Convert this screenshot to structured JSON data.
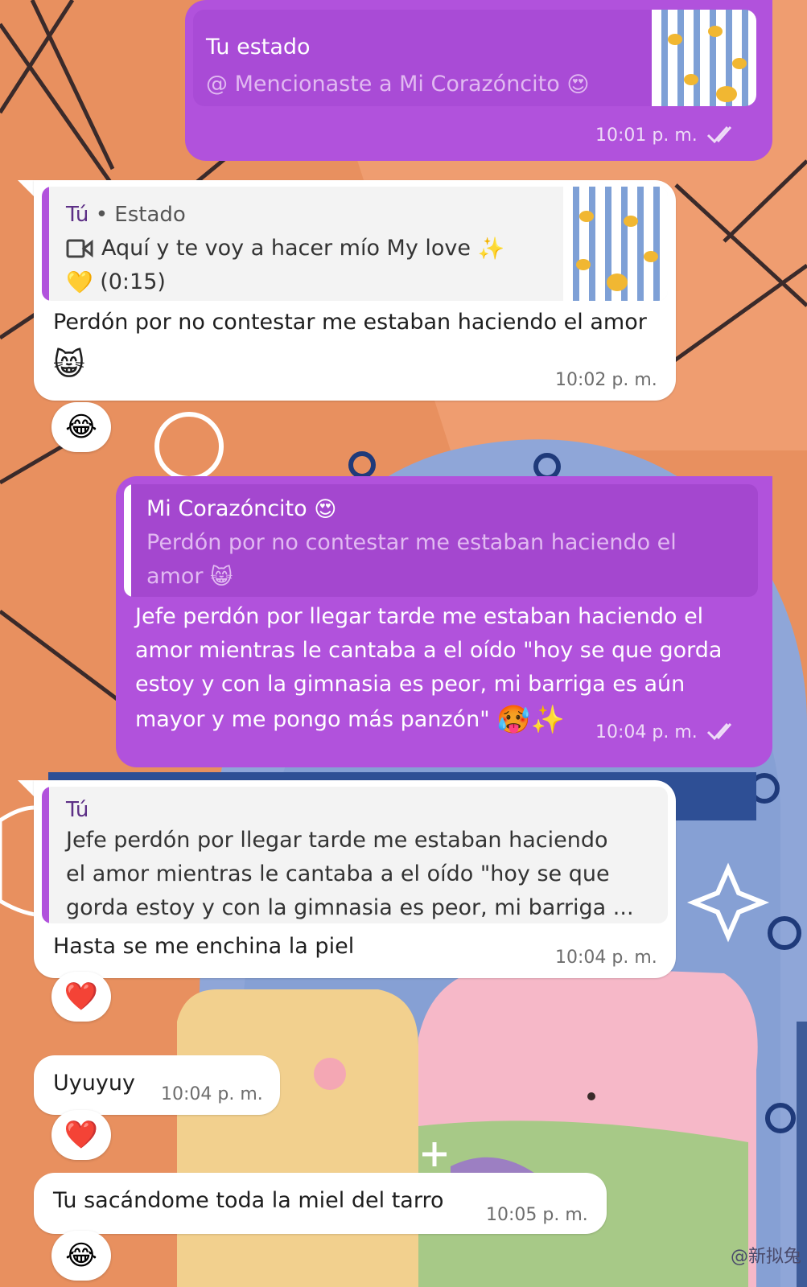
{
  "messages": {
    "m1": {
      "quote_title": "Tu estado",
      "quote_mention_icon": "@",
      "quote_text": "Mencionaste a Mi Corazóncito",
      "quote_emoji": "😍",
      "time": "10:01 p. m."
    },
    "m2": {
      "quote_title_you": "Tú",
      "quote_title_sep": "•",
      "quote_title_status": "Estado",
      "quote_icon": "video-camera-icon",
      "quote_line1": "Aquí y te voy a hacer mío My love",
      "quote_line1_emoji": "✨",
      "quote_line2_emoji": "💛",
      "quote_duration": "(0:15)",
      "text": "Perdón por no contestar me estaban haciendo el amor",
      "text_emoji": "😸",
      "time": "10:02 p. m.",
      "reaction": "😂"
    },
    "m3": {
      "quote_title": "Mi Corazóncito",
      "quote_title_emoji": "😍",
      "quote_line1": "Perdón por no contestar me estaban haciendo el",
      "quote_line2": "amor",
      "quote_line2_emoji": "😸",
      "text_line1": "Jefe perdón por llegar tarde me estaban haciendo el",
      "text_line2": "amor mientras le cantaba a el oído \"hoy se que gorda",
      "text_line3": "estoy y con la gimnasia es peor, mi barriga es aún",
      "text_line4": "mayor y me pongo más panzón\"",
      "text_emoji": "🥵✨",
      "time": "10:04 p. m."
    },
    "m4": {
      "quote_title": "Tú",
      "quote_line1": "Jefe perdón por llegar tarde me estaban haciendo",
      "quote_line2": "el amor mientras le cantaba a el oído \"hoy se que",
      "quote_line3": "gorda estoy y con la gimnasia es peor, mi barriga ...",
      "text": "Hasta se me enchina la piel",
      "time": "10:04 p. m.",
      "reaction": "❤️"
    },
    "m5": {
      "text": "Uyuyuy",
      "time": "10:04 p. m.",
      "reaction": "❤️"
    },
    "m6": {
      "text": "Tu sacándome toda la miel del tarro",
      "time": "10:05 p. m.",
      "reaction": "😂"
    }
  },
  "wallpaper": {
    "watermark": "@新拟兔"
  },
  "colors": {
    "outgoing_bubble": "#b152dc",
    "incoming_bubble": "#ffffff",
    "wallpaper_orange": "#e8905f",
    "wallpaper_blue": "#8fa6d8"
  }
}
